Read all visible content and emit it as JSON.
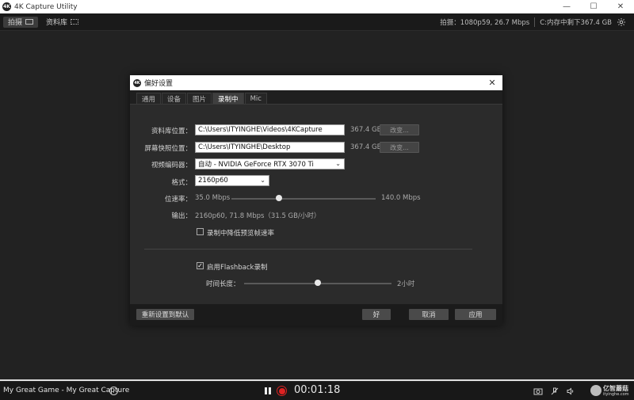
{
  "window": {
    "logo_text": "4K",
    "title": "4K Capture Utility",
    "minimize_glyph": "—",
    "maximize_glyph": "☐",
    "close_glyph": "✕"
  },
  "toolbar": {
    "tabs": [
      {
        "label": "拍摄",
        "icon": "capture-icon",
        "active": true
      },
      {
        "label": "资料库",
        "icon": "library-icon",
        "active": false
      }
    ],
    "capture_status": "拍摄：1080p59, 26.7 Mbps",
    "storage_status": "C:内存中剩下367.4 GB",
    "settings_icon": "gear-icon"
  },
  "dialog": {
    "logo_text": "4K",
    "title": "偏好设置",
    "close_glyph": "✕",
    "tabs": [
      {
        "label": "通用",
        "active": false
      },
      {
        "label": "设备",
        "active": false
      },
      {
        "label": "图片",
        "active": false
      },
      {
        "label": "录制中",
        "active": true
      },
      {
        "label": "Mic",
        "active": false
      }
    ],
    "library_location": {
      "label": "资料库位置：",
      "value": "C:\\Users\\ITYINGHE\\Videos\\4KCapture",
      "free": "367.4 GB",
      "change_label": "改变..."
    },
    "screenshot_location": {
      "label": "屏幕快照位置：",
      "value": "C:\\Users\\ITYINGHE\\Desktop",
      "free": "367.4 GB",
      "change_label": "改变..."
    },
    "video_encoder": {
      "label": "视频编码器：",
      "value": "自动 - NVIDIA GeForce RTX 3070 Ti"
    },
    "format": {
      "label": "格式：",
      "value": "2160p60"
    },
    "bitrate": {
      "label": "位速率：",
      "min": "35.0 Mbps",
      "max": "140.0 Mbps",
      "level": 0.33
    },
    "output": {
      "label": "输出：",
      "value": "2160p60, 71.8 Mbps（31.5 GB/小时）"
    },
    "reduce_preview": {
      "label": "录制中降低预览帧速率",
      "checked": false
    },
    "flashback": {
      "label": "启用Flashback录制",
      "checked": true,
      "check_glyph": "✓"
    },
    "duration": {
      "label": "时间长度：",
      "max": "2小时",
      "level": 0.5
    },
    "footer": {
      "reset_label": "重新设置到默认",
      "ok_label": "好",
      "cancel_label": "取消",
      "apply_label": "应用"
    }
  },
  "bottom": {
    "capture_name": "My Great Game - My Great Capture",
    "info_glyph": "i",
    "timer": "00:01:18",
    "rec_color": "#dd2222",
    "watermark_text_1": "亿智蘑菇",
    "watermark_text_2": "ityinghe.com"
  }
}
